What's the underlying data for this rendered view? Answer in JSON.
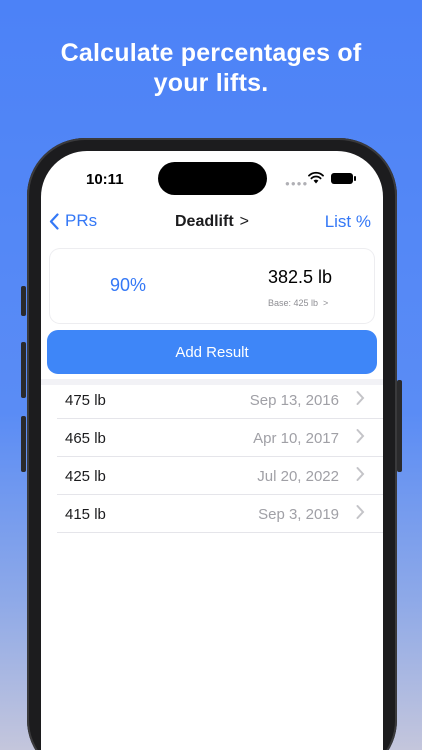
{
  "headline": {
    "line1": "Calculate percentages of",
    "line2": "your lifts."
  },
  "status": {
    "time": "10:11"
  },
  "nav": {
    "back_label": "PRs",
    "title": "Deadlift",
    "right_label": "List %"
  },
  "calculator": {
    "percentage": "90%",
    "result": "382.5 lb",
    "base": "Base: 425 lb"
  },
  "add_button": {
    "label": "Add Result"
  },
  "results": [
    {
      "weight": "475 lb",
      "date": "Sep 13, 2016"
    },
    {
      "weight": "465 lb",
      "date": "Apr 10, 2017"
    },
    {
      "weight": "425 lb",
      "date": "Jul 20, 2022"
    },
    {
      "weight": "415 lb",
      "date": "Sep 3, 2019"
    }
  ],
  "colors": {
    "accent": "#3478f6",
    "background": "#4c82f7",
    "button": "#3e86f8"
  }
}
